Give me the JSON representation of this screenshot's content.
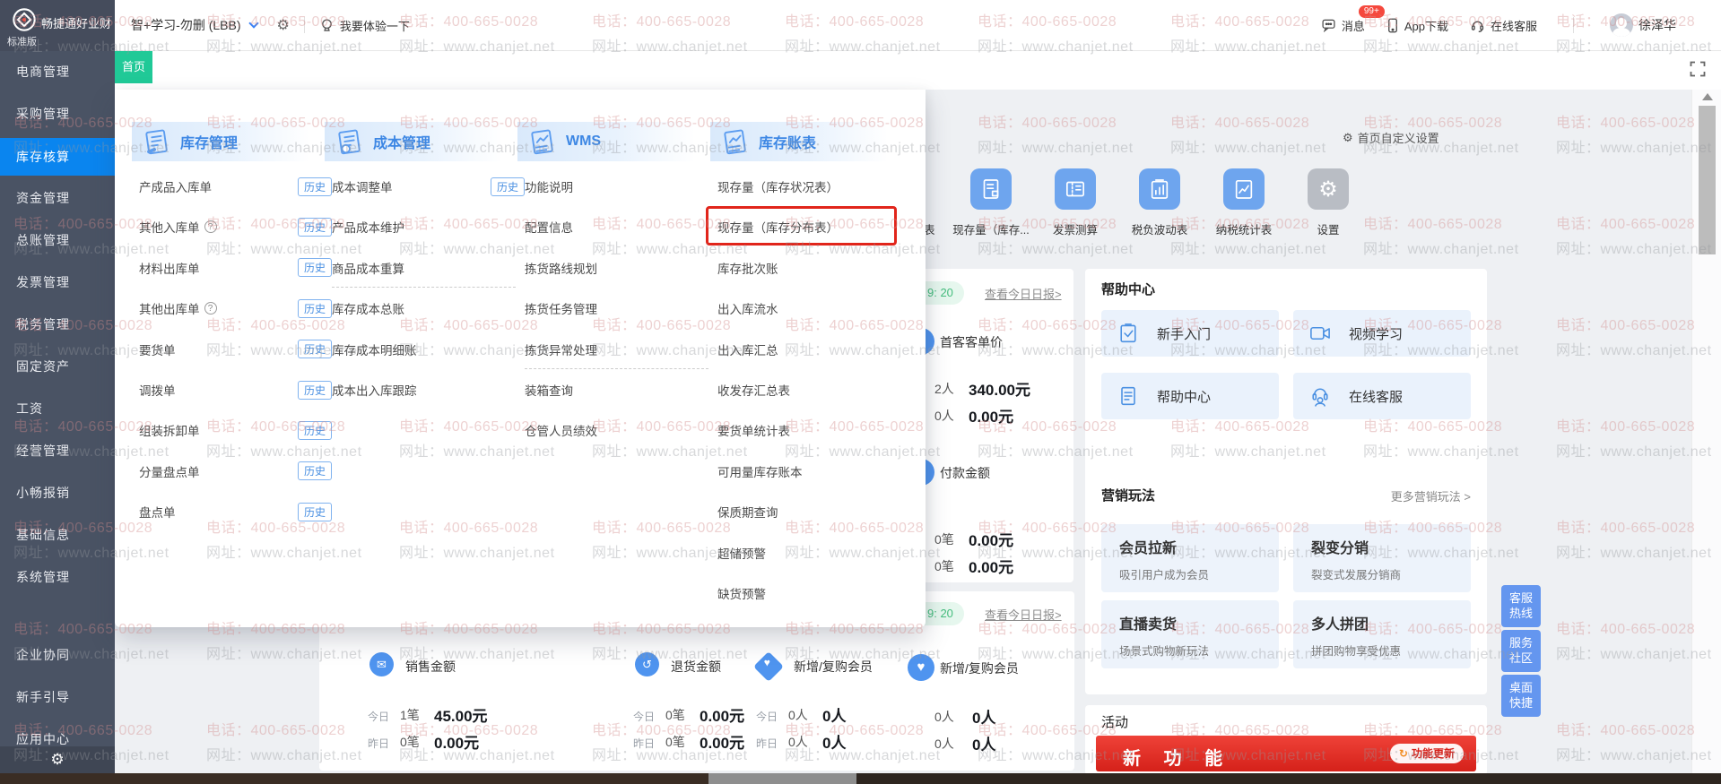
{
  "watermark": {
    "phone_line": "电话：400-665-0028",
    "site_line": "网址：www.chanjet.net"
  },
  "topbar": {
    "logo_title": "畅捷通好业财",
    "logo_subtitle": "标准版",
    "org_name": "智+学习-勿删 (LBB)",
    "experience_label": "我要体验一下",
    "messages_label": "消息",
    "messages_badge": "99+",
    "app_download_label": "App下载",
    "online_service_label": "在线客服",
    "username": "徐泽华"
  },
  "sidebar": {
    "items": [
      {
        "label": "电商管理",
        "active": false
      },
      {
        "label": "采购管理",
        "active": false
      },
      {
        "label": "库存核算",
        "active": true
      },
      {
        "label": "资金管理",
        "active": false
      },
      {
        "label": "总账管理",
        "active": false
      },
      {
        "label": "发票管理",
        "active": false
      },
      {
        "label": "税务管理",
        "active": false
      },
      {
        "label": "固定资产",
        "active": false
      },
      {
        "label": "工资",
        "active": false
      },
      {
        "label": "经营管理",
        "active": false
      },
      {
        "label": "小畅报销",
        "active": false
      },
      {
        "label": "基础信息",
        "active": false
      },
      {
        "label": "系统管理",
        "active": false
      },
      {
        "label": "企业协同",
        "active": false
      },
      {
        "label": "新手引导",
        "active": false
      },
      {
        "label": "应用中心",
        "active": false
      }
    ]
  },
  "tabbar": {
    "home_tab": "首页"
  },
  "menu": {
    "history_badge": "历史",
    "columns": [
      {
        "title": "库存管理",
        "icon": "doc-edit-icon",
        "items": [
          {
            "label": "产成品入库单",
            "history": true
          },
          {
            "label": "其他入库单",
            "history": true,
            "help": true
          },
          {
            "label": "材料出库单",
            "history": true
          },
          {
            "label": "其他出库单",
            "history": true,
            "help": true
          },
          {
            "label": "要货单",
            "history": true
          },
          {
            "label": "调拨单",
            "history": true
          },
          {
            "label": "组装拆卸单",
            "history": true
          },
          {
            "label": "分量盘点单",
            "history": true
          },
          {
            "label": "盘点单",
            "history": true
          }
        ]
      },
      {
        "title": "成本管理",
        "icon": "doc-search-icon",
        "items": [
          {
            "label": "成本调整单",
            "history": true
          },
          {
            "label": "产品成本维护"
          },
          {
            "label": "商品成本重算",
            "divider_after": true
          },
          {
            "label": "库存成本总账"
          },
          {
            "label": "库存成本明细账"
          },
          {
            "label": "成本出入库跟踪"
          }
        ]
      },
      {
        "title": "WMS",
        "icon": "doc-chart-icon",
        "items": [
          {
            "label": "功能说明"
          },
          {
            "label": "配置信息"
          },
          {
            "label": "拣货路线规划"
          },
          {
            "label": "拣货任务管理"
          },
          {
            "label": "拣货异常处理",
            "divider_after": true
          },
          {
            "label": "装箱查询"
          },
          {
            "label": "仓管人员绩效"
          }
        ]
      },
      {
        "title": "库存账表",
        "icon": "doc-chart-icon",
        "items": [
          {
            "label": "现存量（库存状况表）"
          },
          {
            "label": "现存量（库存分布表）",
            "highlighted": true
          },
          {
            "label": "库存批次账"
          },
          {
            "label": "出入库流水"
          },
          {
            "label": "出入库汇总"
          },
          {
            "label": "收发存汇总表"
          },
          {
            "label": "要货单统计表"
          },
          {
            "label": "可用量库存账本"
          },
          {
            "label": "保质期查询"
          },
          {
            "label": "超储预警"
          },
          {
            "label": "缺货预警"
          }
        ]
      }
    ]
  },
  "dashboard": {
    "customize_label": "首页自定义设置",
    "shortcuts": {
      "clipped_label": "表",
      "items": [
        {
          "label": "现存量（库存...",
          "icon": "doc-icon",
          "color": "#6ea5ee"
        },
        {
          "label": "发票测算",
          "icon": "ticket-icon",
          "color": "#6ea5ee"
        },
        {
          "label": "税负波动表",
          "icon": "clipboard-chart-icon",
          "color": "#6ea5ee"
        },
        {
          "label": "纳税统计表",
          "icon": "doc-chart2-icon",
          "color": "#6ea5ee"
        },
        {
          "label": "设置",
          "icon": "gear-icon",
          "color": "#b9bdc4"
        }
      ]
    },
    "report_card_1": {
      "time": "9: 20",
      "link": "查看今日日报>",
      "sections": [
        {
          "label": "首客客单价",
          "icon": "price-icon",
          "glyph": "¥",
          "rows": [
            {
              "count": "2人",
              "amount": "340.00元"
            },
            {
              "count": "0人",
              "amount": "0.00元"
            }
          ]
        },
        {
          "label": "付款金额",
          "icon": "payment-icon",
          "glyph": "¥",
          "rows": [
            {
              "count": "0笔",
              "amount": "0.00元"
            },
            {
              "count": "0笔",
              "amount": "0.00元"
            }
          ]
        }
      ]
    },
    "report_card_2": {
      "time": "9: 20",
      "link": "查看今日日报>",
      "section": {
        "label": "新增/复购会员",
        "icon": "member-icon",
        "glyph": "♥",
        "rows": [
          {
            "count": "0人",
            "amount": "0人"
          },
          {
            "count": "0人",
            "amount": "0人"
          }
        ]
      },
      "stats": [
        {
          "label": "销售金额",
          "icon": "sales-icon",
          "glyph": "✉",
          "shape": "circle",
          "rows": [
            {
              "day": "今日",
              "count": "1笔",
              "amount": "45.00元"
            },
            {
              "day": "昨日",
              "count": "0笔",
              "amount": "0.00元"
            }
          ]
        },
        {
          "label": "退货金额",
          "icon": "return-icon",
          "glyph": "↺",
          "shape": "circle",
          "rows": [
            {
              "day": "今日",
              "count": "0笔",
              "amount": "0.00元"
            },
            {
              "day": "昨日",
              "count": "0笔",
              "amount": "0.00元"
            }
          ]
        },
        {
          "label": "新增/复购会员",
          "icon": "member-diamond-icon",
          "glyph": "♥",
          "shape": "diamond",
          "rows": [
            {
              "day": "今日",
              "count": "0人",
              "amount": "0人"
            },
            {
              "day": "昨日",
              "count": "0人",
              "amount": "0人"
            }
          ]
        }
      ]
    },
    "help_center": {
      "title": "帮助中心",
      "tiles": [
        {
          "label": "新手入门",
          "icon": "clipboard-check-icon"
        },
        {
          "label": "视频学习",
          "icon": "video-icon"
        },
        {
          "label": "帮助中心",
          "icon": "doc-lines-icon"
        },
        {
          "label": "在线客服",
          "icon": "headset-person-icon"
        }
      ]
    },
    "marketing": {
      "title": "营销玩法",
      "more_link": "更多营销玩法 >",
      "tiles": [
        {
          "title": "会员拉新",
          "desc": "吸引用户成为会员"
        },
        {
          "title": "裂变分销",
          "desc": "裂变式发展分销商"
        },
        {
          "title": "直播卖货",
          "desc": "场景式购物新玩法"
        },
        {
          "title": "多人拼团",
          "desc": "拼团购物享受优惠"
        }
      ]
    },
    "activity": {
      "title": "活动",
      "banner_text": "新 功 能",
      "update_label": "功能更新"
    },
    "floating_buttons": [
      "客服热线",
      "服务社区",
      "桌面快捷"
    ]
  }
}
